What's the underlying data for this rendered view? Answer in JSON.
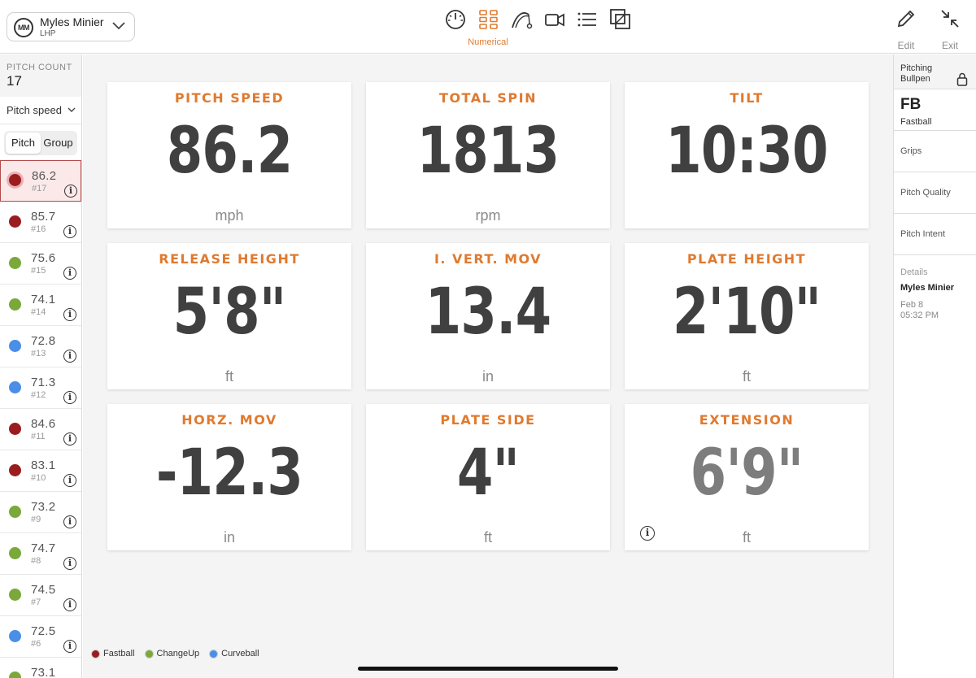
{
  "player": {
    "initials": "MM",
    "name": "Myles Minier",
    "hand": "LHP"
  },
  "nav": {
    "active_label": "Numerical",
    "icons": [
      "gauge-icon",
      "grid-icon",
      "trajectory-icon",
      "video-icon",
      "list-icon",
      "overlay-icon"
    ]
  },
  "toolbar": {
    "edit_label": "Edit",
    "exit_label": "Exit"
  },
  "sidebar": {
    "pitch_count_label": "PITCH COUNT",
    "pitch_count": "17",
    "metric": "Pitch speed",
    "segments": [
      "Pitch",
      "Group"
    ],
    "pitches": [
      {
        "value": "86.2",
        "num": "#17",
        "type": "Fastball",
        "color": "#9b1c1f"
      },
      {
        "value": "85.7",
        "num": "#16",
        "type": "Fastball",
        "color": "#9b1c1f"
      },
      {
        "value": "75.6",
        "num": "#15",
        "type": "ChangeUp",
        "color": "#7aa83a"
      },
      {
        "value": "74.1",
        "num": "#14",
        "type": "ChangeUp",
        "color": "#7aa83a"
      },
      {
        "value": "72.8",
        "num": "#13",
        "type": "Curveball",
        "color": "#4a8ee8"
      },
      {
        "value": "71.3",
        "num": "#12",
        "type": "Curveball",
        "color": "#4a8ee8"
      },
      {
        "value": "84.6",
        "num": "#11",
        "type": "Fastball",
        "color": "#9b1c1f"
      },
      {
        "value": "83.1",
        "num": "#10",
        "type": "Fastball",
        "color": "#9b1c1f"
      },
      {
        "value": "73.2",
        "num": "#9",
        "type": "ChangeUp",
        "color": "#7aa83a"
      },
      {
        "value": "74.7",
        "num": "#8",
        "type": "ChangeUp",
        "color": "#7aa83a"
      },
      {
        "value": "74.5",
        "num": "#7",
        "type": "ChangeUp",
        "color": "#7aa83a"
      },
      {
        "value": "72.5",
        "num": "#6",
        "type": "Curveball",
        "color": "#4a8ee8"
      },
      {
        "value": "73.1",
        "num": "",
        "type": "ChangeUp",
        "color": "#7aa83a"
      }
    ]
  },
  "cards": [
    {
      "title": "PITCH SPEED",
      "value": "86.2",
      "unit": "mph"
    },
    {
      "title": "TOTAL SPIN",
      "value": "1813",
      "unit": "rpm"
    },
    {
      "title": "TILT",
      "value": "10:30",
      "unit": ""
    },
    {
      "title": "RELEASE HEIGHT",
      "value": "5'8\"",
      "unit": "ft"
    },
    {
      "title": "I. VERT. MOV",
      "value": "13.4",
      "unit": "in"
    },
    {
      "title": "PLATE HEIGHT",
      "value": "2'10\"",
      "unit": "ft"
    },
    {
      "title": "HORZ. MOV",
      "value": "-12.3",
      "unit": "in"
    },
    {
      "title": "PLATE SIDE",
      "value": "4\"",
      "unit": "ft"
    },
    {
      "title": "EXTENSION",
      "value": "6'9\"",
      "unit": "ft"
    }
  ],
  "legend": [
    {
      "label": "Fastball",
      "color": "#9b1c1f"
    },
    {
      "label": "ChangeUp",
      "color": "#7aa83a"
    },
    {
      "label": "Curveball",
      "color": "#4a8ee8"
    }
  ],
  "session": {
    "line1": "Pitching",
    "line2": "Bullpen",
    "pitch_code": "FB",
    "pitch_name": "Fastball",
    "rows": [
      "Grips",
      "Pitch Quality",
      "Pitch Intent"
    ],
    "details_label": "Details",
    "details_name": "Myles Minier",
    "details_date": "Feb 8",
    "details_time": "05:32 PM"
  },
  "colors": {
    "accent": "#e07a2f",
    "value_text": "#404040"
  }
}
